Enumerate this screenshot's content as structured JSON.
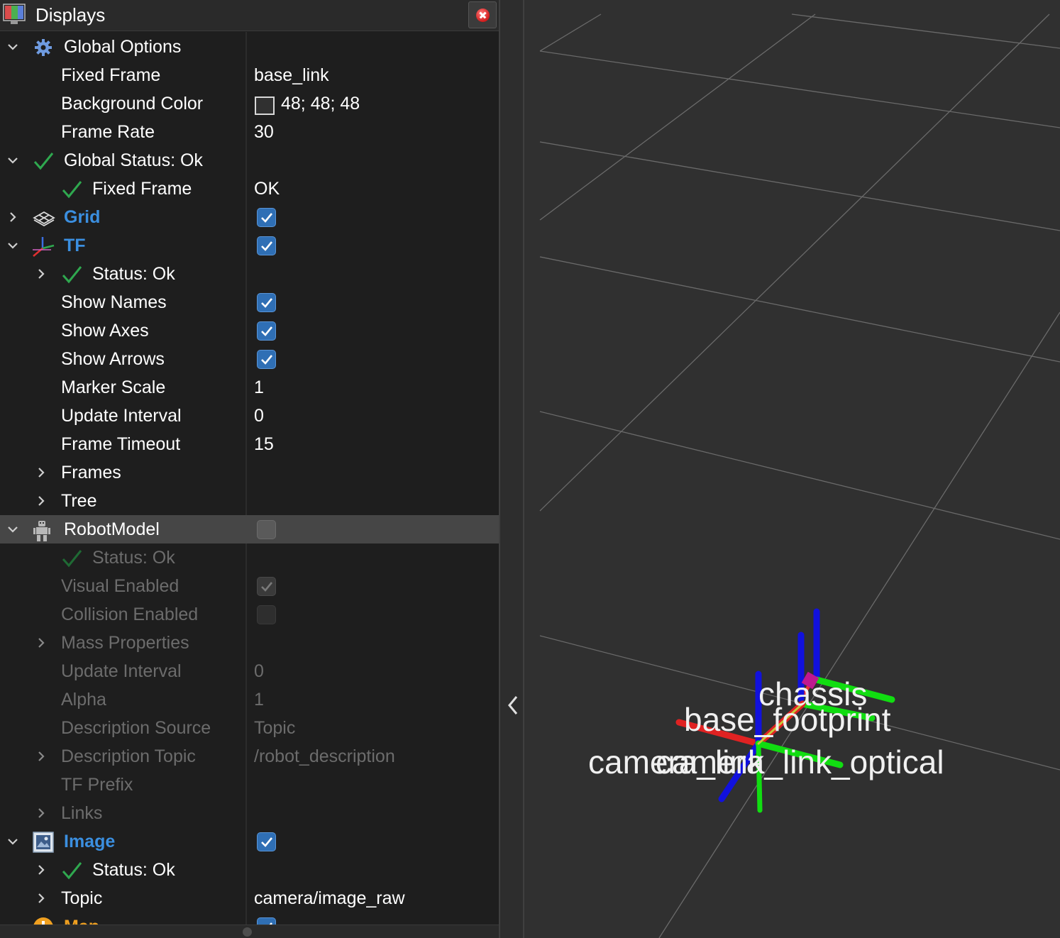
{
  "panel": {
    "title": "Displays"
  },
  "rows": {
    "global_options": "Global Options",
    "fixed_frame": {
      "label": "Fixed Frame",
      "value": "base_link"
    },
    "background_color": {
      "label": "Background Color",
      "value": "48; 48; 48"
    },
    "frame_rate": {
      "label": "Frame Rate",
      "value": "30"
    },
    "global_status": "Global Status: Ok",
    "status_fixed_frame": {
      "label": "Fixed Frame",
      "value": "OK"
    },
    "grid": {
      "label": "Grid",
      "checked": true
    },
    "tf": {
      "label": "TF",
      "checked": true
    },
    "tf_status": "Status: Ok",
    "show_names": {
      "label": "Show Names",
      "checked": true
    },
    "show_axes": {
      "label": "Show Axes",
      "checked": true
    },
    "show_arrows": {
      "label": "Show Arrows",
      "checked": true
    },
    "marker_scale": {
      "label": "Marker Scale",
      "value": "1"
    },
    "tf_update_interval": {
      "label": "Update Interval",
      "value": "0"
    },
    "frame_timeout": {
      "label": "Frame Timeout",
      "value": "15"
    },
    "frames": "Frames",
    "tree": "Tree",
    "robot_model": {
      "label": "RobotModel",
      "checked": false
    },
    "rm_status": "Status: Ok",
    "visual_enabled": {
      "label": "Visual Enabled",
      "checked": true
    },
    "collision_enabled": {
      "label": "Collision Enabled",
      "checked": false
    },
    "mass_properties": "Mass Properties",
    "rm_update_interval": {
      "label": "Update Interval",
      "value": "0"
    },
    "alpha": {
      "label": "Alpha",
      "value": "1"
    },
    "description_source": {
      "label": "Description Source",
      "value": "Topic"
    },
    "description_topic": {
      "label": "Description Topic",
      "value": "/robot_description"
    },
    "tf_prefix": {
      "label": "TF Prefix",
      "value": ""
    },
    "links": "Links",
    "image": {
      "label": "Image",
      "checked": true
    },
    "image_status": "Status: Ok",
    "image_topic": {
      "label": "Topic",
      "value": "camera/image_raw"
    },
    "map_partial": "Map"
  },
  "view": {
    "background_color": "#303030",
    "frame_labels": {
      "chassis": "chassis",
      "base_footprint": "base_footprint",
      "camera_link": "camera_link",
      "camera_link_optical": "camera_link_optical"
    }
  },
  "colors": {
    "accent_blue": "#3b8fe0",
    "checkbox_blue": "#2f6fb5",
    "status_green": "#2fa84f"
  },
  "icons": {
    "displays": "displays-icon",
    "close": "close-icon",
    "global_options": "gear-icon",
    "status_ok": "checkmark-icon",
    "grid": "grid-icon",
    "tf": "tf-axes-icon",
    "robot_model": "robot-icon",
    "image": "image-icon",
    "map": "warning-icon",
    "collapse": "chevron-left-icon"
  }
}
